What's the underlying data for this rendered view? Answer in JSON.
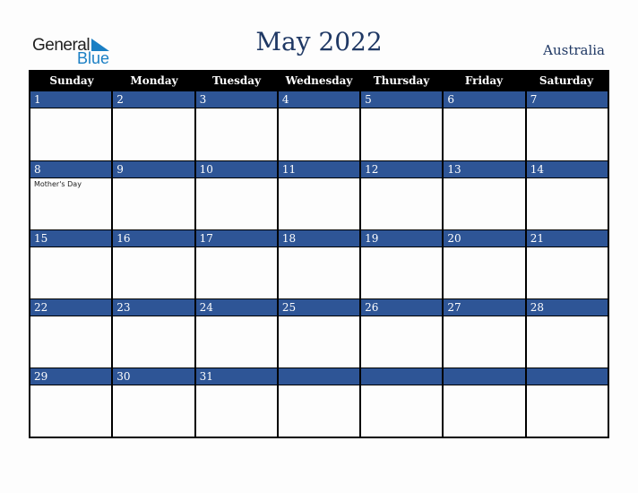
{
  "logo": {
    "general": "General",
    "blue": "Blue"
  },
  "title": "May 2022",
  "country": "Australia",
  "weekdays": [
    "Sunday",
    "Monday",
    "Tuesday",
    "Wednesday",
    "Thursday",
    "Friday",
    "Saturday"
  ],
  "weeks": [
    [
      {
        "d": "1"
      },
      {
        "d": "2"
      },
      {
        "d": "3"
      },
      {
        "d": "4"
      },
      {
        "d": "5"
      },
      {
        "d": "6"
      },
      {
        "d": "7"
      }
    ],
    [
      {
        "d": "8",
        "e": "Mother's Day"
      },
      {
        "d": "9"
      },
      {
        "d": "10"
      },
      {
        "d": "11"
      },
      {
        "d": "12"
      },
      {
        "d": "13"
      },
      {
        "d": "14"
      }
    ],
    [
      {
        "d": "15"
      },
      {
        "d": "16"
      },
      {
        "d": "17"
      },
      {
        "d": "18"
      },
      {
        "d": "19"
      },
      {
        "d": "20"
      },
      {
        "d": "21"
      }
    ],
    [
      {
        "d": "22"
      },
      {
        "d": "23"
      },
      {
        "d": "24"
      },
      {
        "d": "25"
      },
      {
        "d": "26"
      },
      {
        "d": "27"
      },
      {
        "d": "28"
      }
    ],
    [
      {
        "d": "29"
      },
      {
        "d": "30"
      },
      {
        "d": "31"
      },
      {
        "d": ""
      },
      {
        "d": ""
      },
      {
        "d": ""
      },
      {
        "d": ""
      }
    ]
  ],
  "colors": {
    "header_bg": "#000000",
    "date_bar": "#2e5596",
    "title": "#1f3864",
    "logo_blue": "#1a7fc4"
  }
}
